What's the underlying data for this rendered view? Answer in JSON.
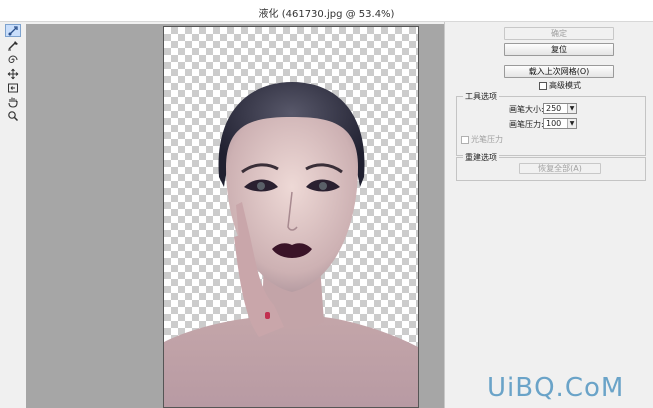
{
  "window": {
    "title": "液化 (461730.jpg @ 53.4%)"
  },
  "toolbar": {
    "tools": [
      {
        "icon": "forward-warp-icon",
        "active": true
      },
      {
        "icon": "reconstruct-brush-icon",
        "active": false
      },
      {
        "icon": "twirl-icon",
        "active": false
      },
      {
        "icon": "bloat-icon",
        "active": false
      },
      {
        "icon": "push-left-icon",
        "active": false
      },
      {
        "icon": "hand-icon",
        "active": false
      },
      {
        "icon": "zoom-icon",
        "active": false
      }
    ]
  },
  "panel": {
    "ok_label": "确定",
    "reset_label": "复位",
    "load_mesh_label": "载入上次网格(O)",
    "advanced_mode_label": "高级模式",
    "tool_options": {
      "legend": "工具选项",
      "brush_size_label": "画笔大小:",
      "brush_size_value": "250",
      "brush_pressure_label": "画笔压力:",
      "brush_pressure_value": "100",
      "stylus_pressure_label": "光笔压力"
    },
    "reconstruct_options": {
      "legend": "重建选项",
      "restore_all_label": "恢复全部(A)"
    }
  },
  "watermark": "UiBQ.CoM"
}
